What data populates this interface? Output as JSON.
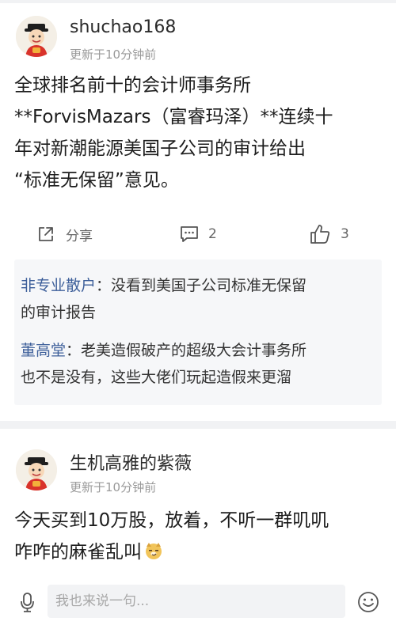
{
  "posts": [
    {
      "username": "shuchao168",
      "time": "更新于10分钟前",
      "content": [
        "全球排名前十的会计师事务所",
        "**ForvisMazars（富睿玛泽）**连续十",
        "年对新潮能源美国子公司的审计给出",
        "“标准无保留”意见。"
      ],
      "actions": {
        "share": "分享",
        "comments": "2",
        "likes": "3"
      },
      "replies": [
        {
          "name": "非专业散户",
          "line1": "：没看到美国子公司标准无保留",
          "line2": "的审计报告"
        },
        {
          "name": "董高堂",
          "line1": "：老美造假破产的超级大会计事务所",
          "line2": "也不是没有，这些大佬们玩起造假来更溜"
        }
      ]
    },
    {
      "username": "生机高雅的紫薇",
      "time": "更新于10分钟前",
      "content": [
        "今天买到10万股，放着，不听一群叽叽",
        "咋咋的麻雀乱叫"
      ],
      "emoji": "smirk-dog-emoji"
    }
  ],
  "composer": {
    "placeholder": "我也来说一句..."
  },
  "icons": [
    "avatar-icon",
    "share-icon",
    "comment-icon",
    "like-icon",
    "microphone-icon",
    "emoji-icon"
  ]
}
